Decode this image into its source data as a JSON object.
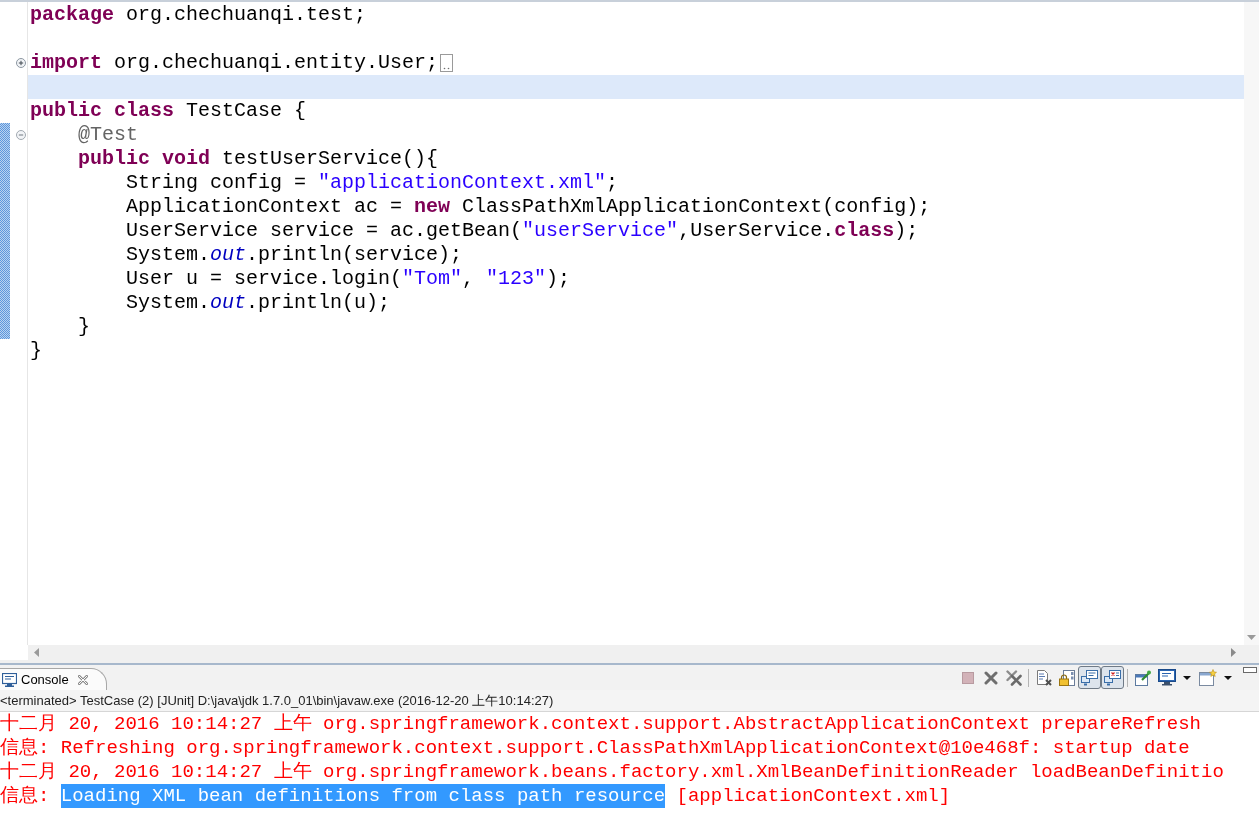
{
  "editor": {
    "lines": [
      {
        "tokens": [
          {
            "kind": "keyword",
            "text": "package"
          },
          {
            "kind": "plain",
            "text": " org.chechuanqi.test;"
          }
        ],
        "current": false,
        "changed": false
      },
      {
        "current": false,
        "changed": false
      },
      {
        "tokens": [
          {
            "kind": "keyword",
            "text": "import"
          },
          {
            "kind": "plain",
            "text": " org.chechuanqi.entity.User;"
          }
        ],
        "folded": true,
        "current": false,
        "changed": false
      },
      {
        "current": true,
        "changed": false
      },
      {
        "tokens": [
          {
            "kind": "keyword",
            "text": "public"
          },
          {
            "kind": "keyword",
            "text": " class"
          },
          {
            "kind": "plain",
            "text": " TestCase {"
          }
        ],
        "current": false,
        "changed": false
      },
      {
        "tokens": [
          {
            "kind": "annotation",
            "text": "    @Test"
          }
        ],
        "folded": false,
        "current": false,
        "changed": true
      },
      {
        "tokens": [
          {
            "kind": "keyword",
            "text": "    public"
          },
          {
            "kind": "keyword",
            "text": " void"
          },
          {
            "kind": "plain",
            "text": " testUserService(){"
          }
        ],
        "current": false,
        "changed": true
      },
      {
        "tokens": [
          {
            "kind": "plain",
            "text": "        String config = "
          },
          {
            "kind": "string",
            "text": "\"applicationContext.xml\""
          },
          {
            "kind": "plain",
            "text": ";"
          }
        ],
        "current": false,
        "changed": true
      },
      {
        "tokens": [
          {
            "kind": "plain",
            "text": "        ApplicationContext ac = "
          },
          {
            "kind": "keyword",
            "text": "new"
          },
          {
            "kind": "plain",
            "text": " ClassPathXmlApplicationContext(config);"
          }
        ],
        "current": false,
        "changed": true
      },
      {
        "tokens": [
          {
            "kind": "plain",
            "text": "        UserService service = ac.getBean("
          },
          {
            "kind": "string",
            "text": "\"userService\""
          },
          {
            "kind": "plain",
            "text": ",UserService."
          },
          {
            "kind": "keyword",
            "text": "class"
          },
          {
            "kind": "plain",
            "text": ");"
          }
        ],
        "current": false,
        "changed": true
      },
      {
        "tokens": [
          {
            "kind": "plain",
            "text": "        System."
          },
          {
            "kind": "field",
            "text": "out"
          },
          {
            "kind": "plain",
            "text": ".println(service);"
          }
        ],
        "current": false,
        "changed": true
      },
      {
        "tokens": [
          {
            "kind": "plain",
            "text": "        User u = service.login("
          },
          {
            "kind": "string",
            "text": "\"Tom\""
          },
          {
            "kind": "plain",
            "text": ", "
          },
          {
            "kind": "string",
            "text": "\"123\""
          },
          {
            "kind": "plain",
            "text": ");"
          }
        ],
        "current": false,
        "changed": true
      },
      {
        "tokens": [
          {
            "kind": "plain",
            "text": "        System."
          },
          {
            "kind": "field",
            "text": "out"
          },
          {
            "kind": "plain",
            "text": ".println(u);"
          }
        ],
        "current": false,
        "changed": true
      },
      {
        "tokens": [
          {
            "kind": "plain",
            "text": "    }"
          }
        ],
        "current": false,
        "changed": true
      },
      {
        "tokens": [
          {
            "kind": "plain",
            "text": "}"
          }
        ],
        "current": false,
        "changed": false
      }
    ]
  },
  "console_view": {
    "tabs": [
      {
        "label": "Console",
        "selected": true
      }
    ],
    "toolbar_groups": [
      [
        {
          "kind": "stop",
          "pressed": false,
          "disabled": true
        },
        {
          "kind": "remove",
          "pressed": false,
          "disabled": false
        },
        {
          "kind": "remove-all",
          "pressed": false,
          "disabled": false
        }
      ],
      [
        {
          "kind": "clear",
          "pressed": false,
          "disabled": false
        },
        {
          "kind": "scroll-lock",
          "pressed": false,
          "disabled": false
        },
        {
          "kind": "stdout",
          "pressed": true,
          "disabled": false
        },
        {
          "kind": "stderr",
          "pressed": true,
          "disabled": false
        }
      ],
      [
        {
          "kind": "pin",
          "pressed": false,
          "disabled": false
        },
        {
          "kind": "display",
          "pressed": false,
          "disabled": false
        },
        {
          "kind": "dropdown",
          "pressed": false,
          "disabled": false
        },
        {
          "kind": "open",
          "pressed": false,
          "disabled": false
        },
        {
          "kind": "dropdown",
          "pressed": false,
          "disabled": false
        }
      ]
    ],
    "view_buttons": [
      {
        "kind": "minimize"
      }
    ],
    "status": "<terminated> TestCase (2) [JUnit] D:\\java\\jdk 1.7.0_01\\bin\\javaw.exe (2016-12-20 上午10:14:27)",
    "lines": [
      {
        "parts": [
          {
            "text": "十二月 20, 2016 10:14:27 上午 org.springframework.context.support.AbstractApplicationContext prepareRefresh",
            "selected": false
          }
        ]
      },
      {
        "parts": [
          {
            "text": "信息: Refreshing org.springframework.context.support.ClassPathXmlApplicationContext@10e468f: startup date",
            "selected": false
          }
        ]
      },
      {
        "parts": [
          {
            "text": "十二月 20, 2016 10:14:27 上午 org.springframework.beans.factory.xml.XmlBeanDefinitionReader loadBeanDefinitio",
            "selected": false
          }
        ]
      },
      {
        "parts": [
          {
            "text": "信息: ",
            "selected": false
          },
          {
            "text": "Loading XML bean definitions from class path resource",
            "selected": true
          },
          {
            "text": " [applicationContext.xml]",
            "selected": false
          }
        ]
      }
    ]
  }
}
